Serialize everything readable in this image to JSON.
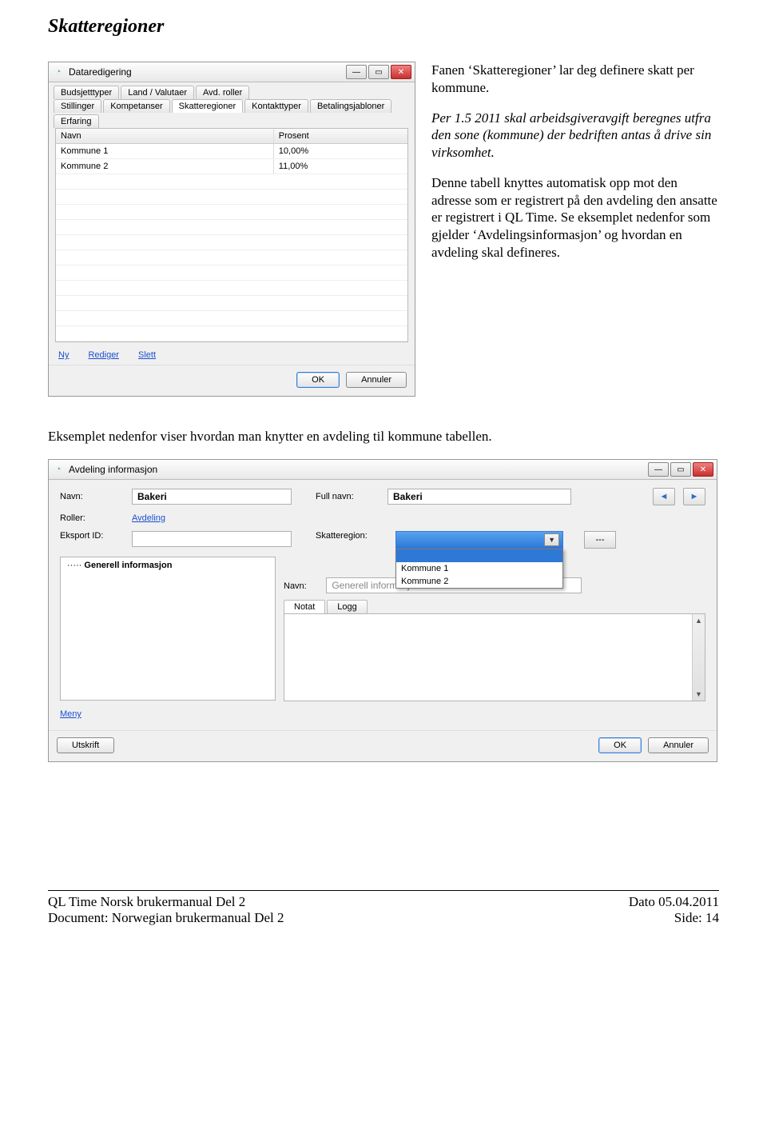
{
  "section_title": "Skatteregioner",
  "window1": {
    "title": "Dataredigering",
    "tabs_row1": [
      "Budsjetttyper",
      "Land / Valutaer",
      "Avd. roller"
    ],
    "tabs_row2": [
      "Stillinger",
      "Kompetanser",
      "Skatteregioner",
      "Kontakttyper",
      "Betalingsjabloner",
      "Erfaring"
    ],
    "active_tab": "Skatteregioner",
    "columns": {
      "name": "Navn",
      "percent": "Prosent"
    },
    "rows": [
      {
        "name": "Kommune 1",
        "percent": "10,00%"
      },
      {
        "name": "Kommune 2",
        "percent": "11,00%"
      }
    ],
    "links": {
      "new": "Ny",
      "edit": "Rediger",
      "delete": "Slett"
    },
    "buttons": {
      "ok": "OK",
      "cancel": "Annuler"
    }
  },
  "side_text": {
    "p1": "Fanen ‘Skatteregioner’ lar deg definere skatt per kommune.",
    "p2": "Per 1.5 2011 skal arbeidsgiveravgift beregnes utfra den sone (kommune) der bedriften antas å drive sin virksomhet.",
    "p3": "Denne tabell knyttes automatisk opp mot den adresse som er registrert på den avdeling den ansatte er registrert i QL Time. Se eksemplet nedenfor som gjelder ‘Avdelingsinformasjon’ og hvordan en avdeling skal defineres."
  },
  "mid_text": "Eksemplet nedenfor viser hvordan man knytter en avdeling til kommune tabellen.",
  "window2": {
    "title": "Avdeling informasjon",
    "labels": {
      "name": "Navn:",
      "fullname": "Full navn:",
      "roles": "Roller:",
      "exportid": "Eksport ID:",
      "region": "Skatteregion:",
      "name2": "Navn:"
    },
    "values": {
      "name": "Bakeri",
      "fullname": "Bakeri",
      "roles": "Avdeling",
      "exportid": "",
      "name2": "Generell informasjon"
    },
    "dropdown_options": [
      "Kommune 1",
      "Kommune 2"
    ],
    "dash_button": "---",
    "tree_node": "Generell informasjon",
    "subtabs": [
      "Notat",
      "Logg"
    ],
    "active_subtab": "Notat",
    "links": {
      "menu": "Meny"
    },
    "buttons": {
      "print": "Utskrift",
      "ok": "OK",
      "cancel": "Annuler"
    }
  },
  "footer": {
    "left1": "QL Time Norsk brukermanual Del 2",
    "left2": "Document: Norwegian brukermanual Del 2",
    "right1": "Dato 05.04.2011",
    "right2": "Side: 14"
  }
}
